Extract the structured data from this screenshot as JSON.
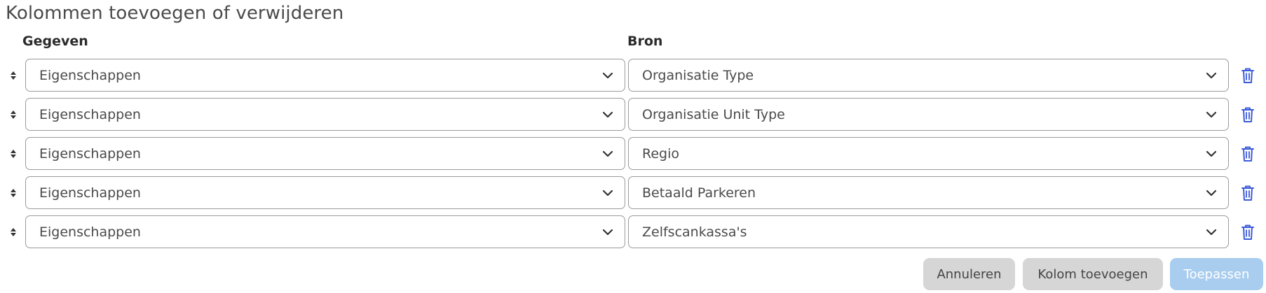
{
  "dialog": {
    "title": "Kolommen toevoegen of verwijderen",
    "column_headers": {
      "data": "Gegeven",
      "source": "Bron"
    },
    "rows": [
      {
        "data": "Eigenschappen",
        "source": "Organisatie Type"
      },
      {
        "data": "Eigenschappen",
        "source": "Organisatie Unit Type"
      },
      {
        "data": "Eigenschappen",
        "source": "Regio"
      },
      {
        "data": "Eigenschappen",
        "source": "Betaald Parkeren"
      },
      {
        "data": "Eigenschappen",
        "source": "Zelfscankassa's"
      }
    ],
    "buttons": {
      "cancel": "Annuleren",
      "add_column": "Kolom toevoegen",
      "apply": "Toepassen"
    }
  },
  "icons": {
    "sort_handle": "sort-icon",
    "dropdown": "chevron-down-icon",
    "delete": "trash-icon"
  },
  "colors": {
    "delete_icon": "#3b5bdb",
    "apply_button": "#a9cdef",
    "secondary_button": "#d6d6d6"
  }
}
